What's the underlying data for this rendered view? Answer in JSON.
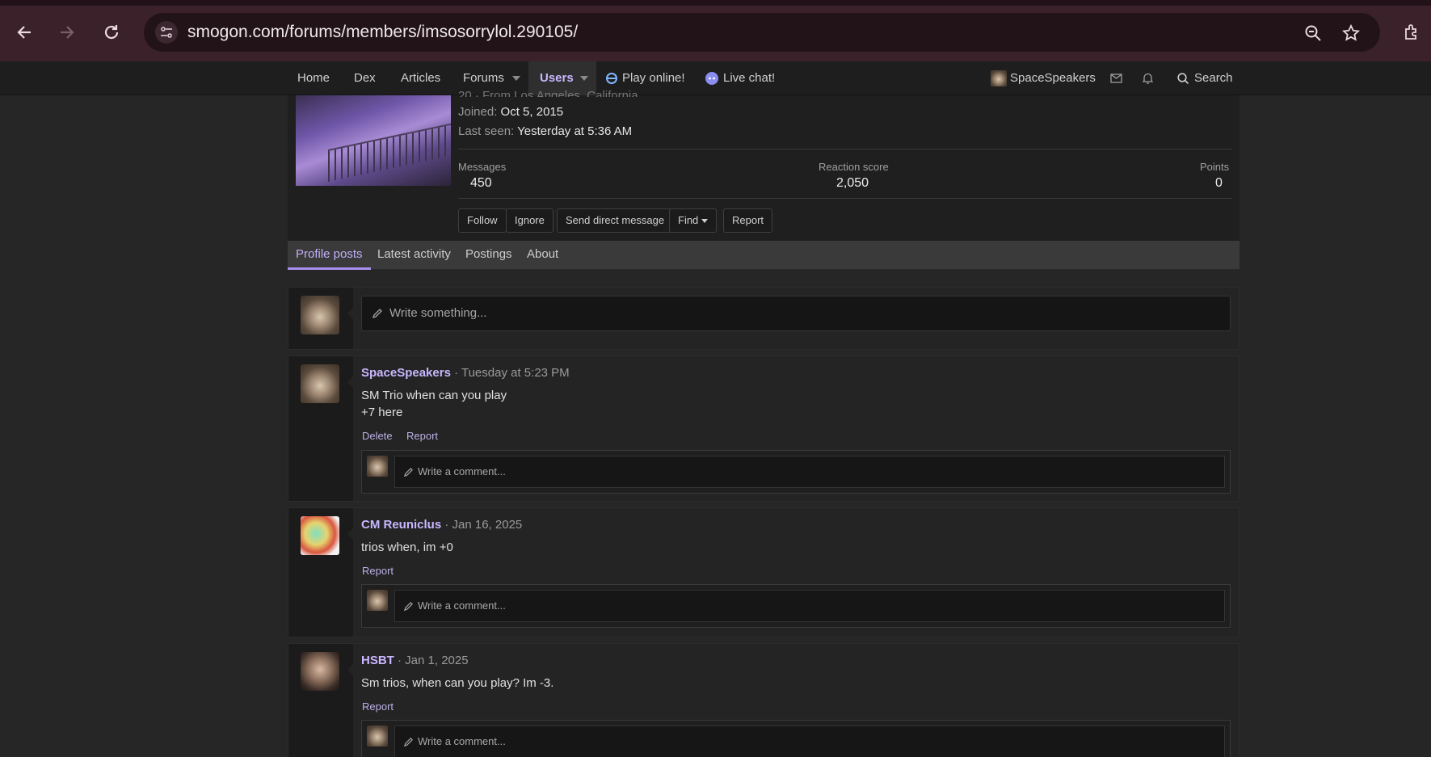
{
  "browser": {
    "url": "smogon.com/forums/members/imsosorrylol.290105/"
  },
  "nav": {
    "items": [
      "Home",
      "Dex",
      "Articles",
      "Forums",
      "Users"
    ],
    "play": "Play online!",
    "chat": "Live chat!",
    "user": "SpaceSpeakers",
    "search": "Search"
  },
  "profile": {
    "location_partial": "20 · From Los Angeles, California",
    "joined_label": "Joined:",
    "joined_value": "Oct 5, 2015",
    "lastseen_label": "Last seen:",
    "lastseen_value": "Yesterday at 5:36 AM",
    "stats": [
      {
        "label": "Messages",
        "value": "450"
      },
      {
        "label": "Reaction score",
        "value": "2,050"
      },
      {
        "label": "Points",
        "value": "0"
      }
    ],
    "buttons": [
      "Follow",
      "Ignore",
      "Send direct message",
      "Find",
      "Report"
    ]
  },
  "tabs": [
    "Profile posts",
    "Latest activity",
    "Postings",
    "About"
  ],
  "composer": {
    "placeholder": "Write something..."
  },
  "posts": [
    {
      "author": "SpaceSpeakers",
      "time": "· Tuesday at 5:23 PM",
      "lines": [
        "SM Trio when can you play",
        "+7 here"
      ],
      "actions": [
        "Delete",
        "Report"
      ],
      "comment_placeholder": "Write a comment..."
    },
    {
      "author": "CM Reuniclus",
      "time": "· Jan 16, 2025",
      "lines": [
        "trios when, im +0"
      ],
      "actions": [
        "Report"
      ],
      "comment_placeholder": "Write a comment..."
    },
    {
      "author": "HSBT",
      "time": "· Jan 1, 2025",
      "lines": [
        "Sm trios, when can you play? Im -3."
      ],
      "actions": [
        "Report"
      ],
      "comment_placeholder": "Write a comment..."
    }
  ]
}
